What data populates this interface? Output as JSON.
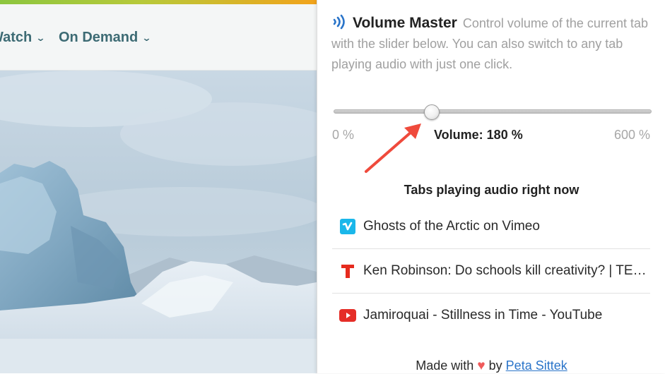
{
  "website": {
    "nav": [
      {
        "label": "Watch"
      },
      {
        "label": "On Demand"
      }
    ]
  },
  "popup": {
    "title": "Volume Master",
    "description": "Control volume of the current tab with the slider below. You can also switch to any tab playing audio with just one click.",
    "slider": {
      "min_label": "0 %",
      "max_label": "600 %",
      "current_label": "Volume: 180 %",
      "min": 0,
      "max": 600,
      "value": 180
    },
    "tabs_heading": "Tabs playing audio right now",
    "tabs": [
      {
        "label": "Ghosts of the Arctic on Vimeo",
        "icon": "vimeo-icon",
        "color": "#1ab7ea"
      },
      {
        "label": "Ken Robinson: Do schools kill creativity? | TED Talk",
        "icon": "ted-icon",
        "color": "#e62b1e"
      },
      {
        "label": "Jamiroquai - Stillness in Time - YouTube",
        "icon": "youtube-icon",
        "color": "#e52d27"
      }
    ],
    "footer": {
      "prefix": "Made with",
      "by": "by",
      "author": "Peta Sittek"
    }
  },
  "colors": {
    "accent": "#2a74c9",
    "annotation_arrow": "#ef4a3c"
  }
}
